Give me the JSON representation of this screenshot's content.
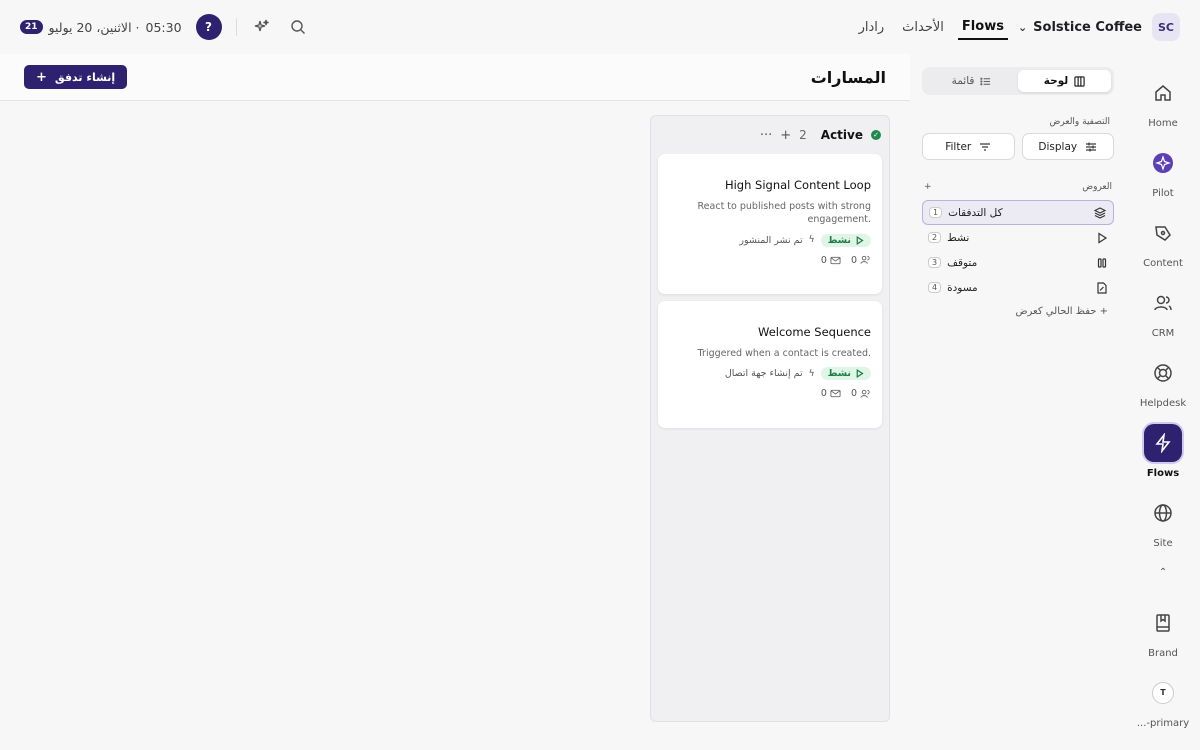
{
  "topbar": {
    "avatar_initials": "SC",
    "org_name": "Solstice Coffee",
    "tabs": [
      "Flows",
      "الأحداث",
      "رادار"
    ],
    "time": "05:30",
    "date": "· الاثنين، 20 يوليو",
    "date_badge": "21"
  },
  "sidebar": {
    "items": [
      {
        "label": "Home",
        "icon": "home-icon"
      },
      {
        "label": "Pilot",
        "icon": "pilot-icon"
      },
      {
        "label": "Content",
        "icon": "pen-icon"
      },
      {
        "label": "CRM",
        "icon": "users-icon"
      },
      {
        "label": "Helpdesk",
        "icon": "lifebuoy-icon"
      },
      {
        "label": "Flows",
        "icon": "bolt-icon"
      },
      {
        "label": "Site",
        "icon": "globe-icon"
      },
      {
        "label": "Brand",
        "icon": "book-icon"
      },
      {
        "label": "...-primary",
        "icon": "t-avatar"
      }
    ],
    "avatar_letter": "T"
  },
  "panel": {
    "seg_board": "لوحة",
    "seg_list": "قائمة",
    "filter_title": "التصفية والعرض",
    "filter_btn": "Filter",
    "display_btn": "Display",
    "views_title": "العروض",
    "views": [
      {
        "label": "كل التدفقات",
        "count": "1"
      },
      {
        "label": "نشط",
        "count": "2"
      },
      {
        "label": "متوقف",
        "count": "3"
      },
      {
        "label": "مسودة",
        "count": "4"
      }
    ],
    "save_current": "+ حفظ الحالي كعرض"
  },
  "main": {
    "title": "المسارات",
    "create_btn": "إنشاء تدفق",
    "column": {
      "name": "Active",
      "count": "2"
    },
    "cards": [
      {
        "title": "High Signal Content Loop",
        "desc": "React to published posts with strong engagement.",
        "status": "نشط",
        "trigger": "تم نشر المنشور",
        "stat_people": "0",
        "stat_mail": "0"
      },
      {
        "title": "Welcome Sequence",
        "desc": "Triggered when a contact is created.",
        "status": "نشط",
        "trigger": "تم إنشاء جهة اتصال",
        "stat_people": "0",
        "stat_mail": "0"
      }
    ]
  }
}
